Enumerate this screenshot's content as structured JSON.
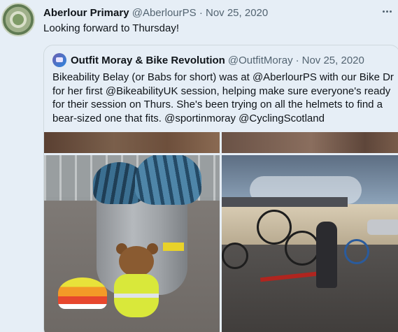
{
  "tweet": {
    "author_name": "Aberlour Primary",
    "author_handle": "@AberlourPS",
    "separator": "·",
    "date": "Nov 25, 2020",
    "text": "Looking forward to Thursday!"
  },
  "quoted": {
    "author_name": "Outfit Moray & Bike Revolution",
    "author_handle": "@OutfitMoray",
    "separator": "·",
    "date": "Nov 25, 2020",
    "text": "Bikeability Belay (or Babs for short) was at @AberlourPS with our Bike Dr for her first @BikeabilityUK session, helping make sure everyone's ready for their session on Thurs. She's been trying on all the helmets to find a bear-sized one that fits. @sportinmoray @CyclingScotland"
  },
  "icons": {
    "more": "more-horizontal-icon"
  },
  "colors": {
    "background": "#e6eef6",
    "secondary_text": "#536471",
    "border": "#cfd9de"
  }
}
